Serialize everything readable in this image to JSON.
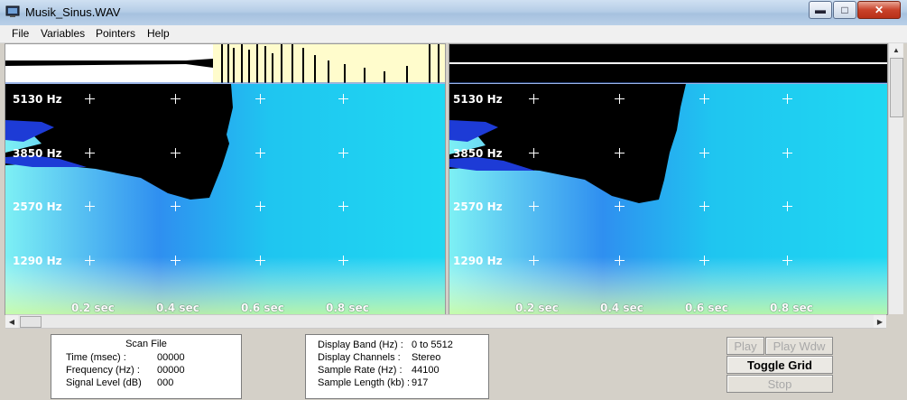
{
  "window": {
    "title": "Musik_Sinus.WAV"
  },
  "menu": [
    "File",
    "Variables",
    "Pointers",
    "Help"
  ],
  "spectrogram": {
    "freq_labels": [
      "5130 Hz",
      "3850 Hz",
      "2570 Hz",
      "1290 Hz"
    ],
    "time_labels": [
      "0.2 sec",
      "0.4 sec",
      "0.6 sec",
      "0.8 sec"
    ]
  },
  "scan_file": {
    "title": "Scan File",
    "rows": [
      {
        "label": "Time (msec) :",
        "value": "00000"
      },
      {
        "label": "Frequency (Hz) :",
        "value": "00000"
      },
      {
        "label": "Signal Level (dB)",
        "value": "000"
      }
    ]
  },
  "display_info": {
    "rows": [
      {
        "label": "Display Band (Hz) :",
        "value": "0 to 5512"
      },
      {
        "label": "Display Channels :",
        "value": "Stereo"
      },
      {
        "label": "Sample Rate (Hz) :",
        "value": "44100"
      },
      {
        "label": "Sample Length (kb) :",
        "value": "917"
      }
    ]
  },
  "buttons": {
    "play": "Play",
    "play_wdw": "Play Wdw",
    "toggle_grid": "Toggle Grid",
    "stop": "Stop"
  },
  "icons": [
    "app-icon",
    "minimize-icon",
    "maximize-icon",
    "close-icon",
    "scroll-left-icon",
    "scroll-right-icon",
    "scroll-up-icon"
  ],
  "colors": {
    "waveform": "#fffccc",
    "spectrum_low": "#7ef0f0",
    "spectrum_high": "#1a4de6"
  }
}
